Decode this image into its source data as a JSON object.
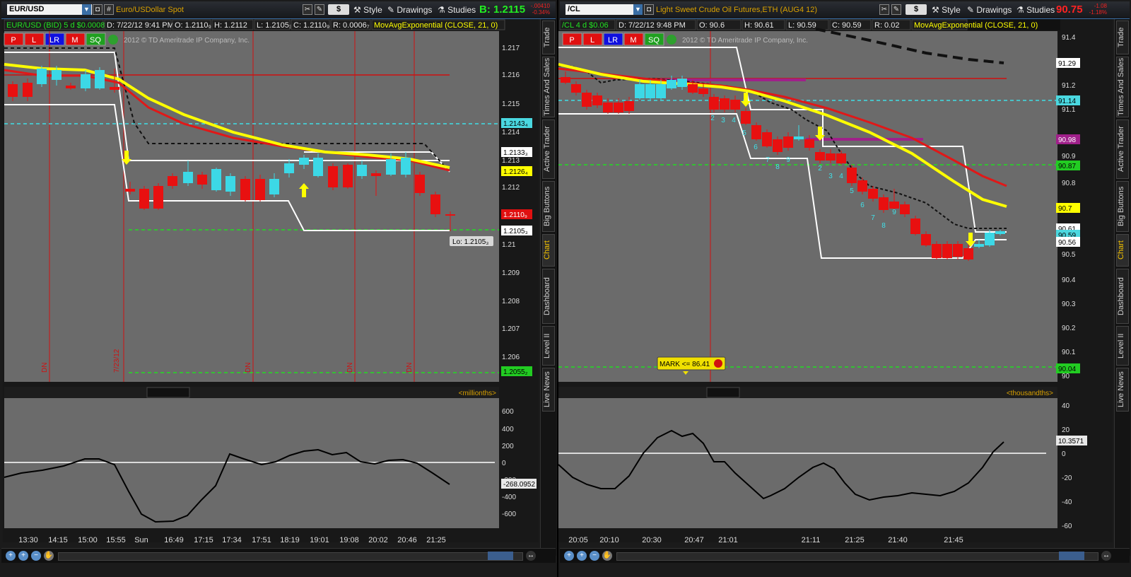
{
  "left": {
    "symbol": "EUR/USD",
    "description": "Euro/USDollar Spot",
    "toolbar": {
      "style": "Style",
      "drawings": "Drawings",
      "studies": "Studies",
      "dollar": "$",
      "hash": "#"
    },
    "price_label": "B: 1.2115",
    "change_top": "-.00410",
    "change_bottom": "-0.34%",
    "header": {
      "sym": "EUR/USD (BID) 5 d $0.0008",
      "date": "D: 7/22/12 9:41 PM",
      "open": "O: 1.2110₉",
      "high": "H: 1.2112",
      "low": "L: 1.2105₃",
      "close": "C: 1.2110₉",
      "range": "R: 0.0006₇",
      "study": "MovAvgExponential (CLOSE, 21, 0)"
    },
    "buttons": [
      "P",
      "L",
      "LR",
      "M",
      "SQ"
    ],
    "copyright": "2012 © TD Ameritrade IP Company, Inc.",
    "price_axis": [
      "1.217",
      "1.216",
      "1.215",
      "1.214",
      "1.213",
      "1.212",
      "1.211",
      "1.21",
      "1.209",
      "1.208",
      "1.207",
      "1.206"
    ],
    "price_tags": [
      {
        "text": "1.2143₄",
        "bg": "#4ad8e0",
        "fg": "#000"
      },
      {
        "text": "1.2133₃",
        "bg": "#ffffff",
        "fg": "#000"
      },
      {
        "text": "1.2126₄",
        "bg": "#ffff00",
        "fg": "#000"
      },
      {
        "text": "1.2110₉",
        "bg": "#e01010",
        "fg": "#fff"
      },
      {
        "text": "1.2105₃",
        "bg": "#ffffff",
        "fg": "#000"
      },
      {
        "text": "1.2055₂",
        "bg": "#22cc22",
        "fg": "#000"
      }
    ],
    "lo_label": "Lo: 1.2105₃",
    "dn_labels": [
      "DN",
      "DN",
      "DN",
      "DN",
      "DN"
    ],
    "date_marker": "7/23/12",
    "osc_unit": "<millionths>",
    "osc_axis": [
      "600",
      "400",
      "200",
      "0",
      "-200",
      "-400",
      "-600"
    ],
    "osc_value": "-268.0952",
    "time_axis": [
      "13:30",
      "14:15",
      "15:00",
      "15:55",
      "Sun",
      "16:49",
      "17:15",
      "17:34",
      "17:51",
      "18:19",
      "19:01",
      "19:08",
      "20:02",
      "20:46",
      "21:25"
    ]
  },
  "right": {
    "symbol": "/CL",
    "description": "Light Sweet Crude Oil Futures,ETH (AUG4 12)",
    "toolbar": {
      "style": "Style",
      "drawings": "Drawings",
      "studies": "Studies",
      "dollar": "$"
    },
    "price_label": "90.75",
    "change_top": "-1.08",
    "change_bottom": "-1.18%",
    "header": {
      "sym": "/CL 4 d $0.06",
      "date": "D: 7/22/12 9:48 PM",
      "open": "O: 90.6",
      "high": "H: 90.61",
      "low": "L: 90.59",
      "close": "C: 90.59",
      "range": "R: 0.02",
      "study": "MovAvgExponential (CLOSE, 21, 0)"
    },
    "buttons": [
      "P",
      "L",
      "LR",
      "M",
      "SQ"
    ],
    "copyright": "2012 © TD Ameritrade IP Company, Inc.",
    "price_axis": [
      "91.4",
      "91.2",
      "91.1",
      "90.9",
      "90.8",
      "90.5",
      "90.4",
      "90.3",
      "90.2",
      "90.1",
      "90"
    ],
    "price_tags": [
      {
        "text": "91.29",
        "bg": "#ffffff",
        "fg": "#000"
      },
      {
        "text": "91.14",
        "bg": "#4ad8e0",
        "fg": "#000"
      },
      {
        "text": "90.98",
        "bg": "#a0208a",
        "fg": "#fff"
      },
      {
        "text": "90.87",
        "bg": "#22cc22",
        "fg": "#000"
      },
      {
        "text": "90.7",
        "bg": "#ffff00",
        "fg": "#000"
      },
      {
        "text": "90.61",
        "bg": "#ffffff",
        "fg": "#000"
      },
      {
        "text": "90.59",
        "bg": "#4ad8e0",
        "fg": "#000"
      },
      {
        "text": "90.56",
        "bg": "#ffffff",
        "fg": "#000"
      },
      {
        "text": "90.04",
        "bg": "#22cc22",
        "fg": "#000"
      }
    ],
    "mark_label": "MARK <= 86.41",
    "seq_numbers": [
      "2",
      "3",
      "4",
      "5",
      "6",
      "7",
      "8",
      "9",
      "2",
      "3",
      "4",
      "5",
      "6",
      "7",
      "8",
      "9"
    ],
    "osc_unit": "<thousandths>",
    "osc_axis": [
      "40",
      "20",
      "0",
      "-20",
      "-40",
      "-60"
    ],
    "osc_value": "10.3571",
    "time_axis": [
      "20:05",
      "20:10",
      "20:30",
      "20:47",
      "21:01",
      "21:11",
      "21:25",
      "21:40",
      "21:45"
    ]
  },
  "sidetabs": [
    "Trade",
    "Times And Sales",
    "Active Trader",
    "Big Buttons",
    "Chart",
    "Dashboard",
    "Level II",
    "Live News"
  ],
  "colors": {
    "up": "#3cd8e6",
    "down": "#e81010",
    "ema_yellow": "#ffff00",
    "ema_red": "#e01818",
    "bg": "#6a6a6a"
  }
}
